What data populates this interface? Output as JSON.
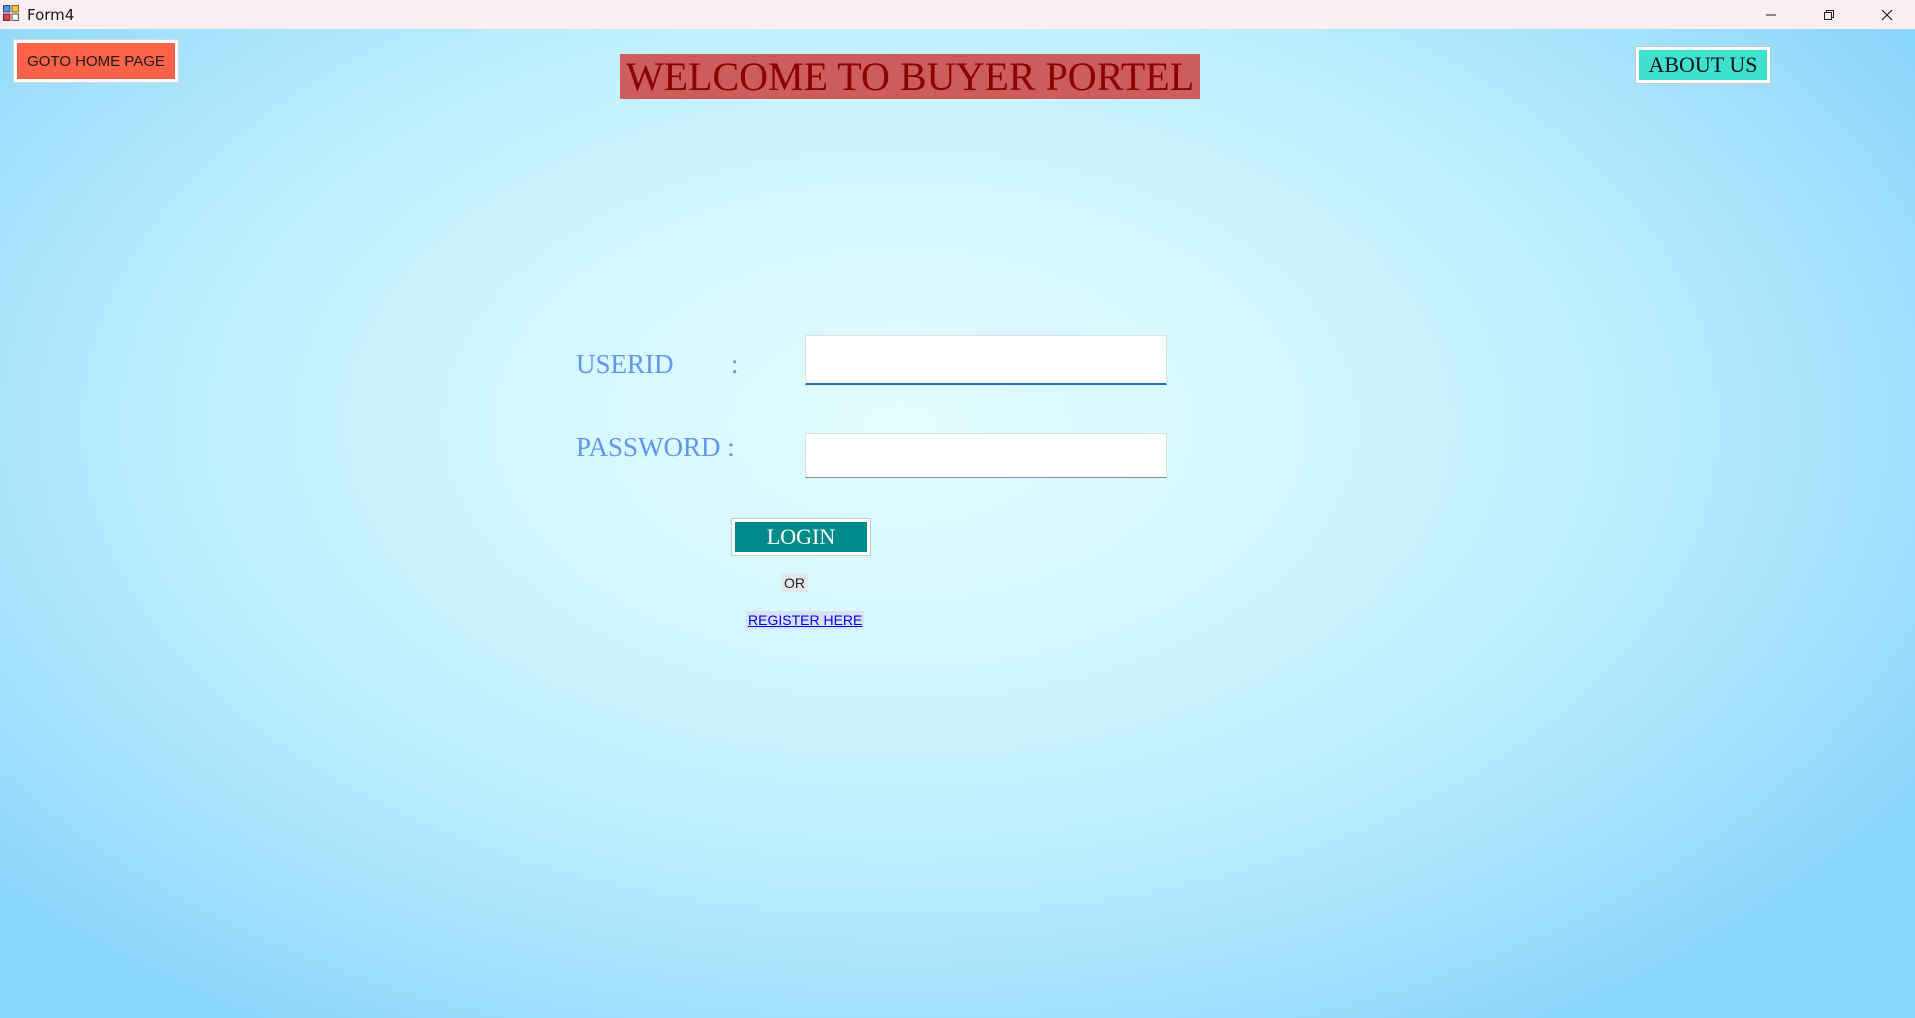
{
  "window": {
    "title": "Form4",
    "icons": {
      "app": "form-app-icon",
      "minimize": "minimize-icon",
      "restore": "restore-icon",
      "close": "close-icon"
    }
  },
  "header": {
    "home_button_label": "GOTO HOME PAGE",
    "page_title": "WELCOME TO BUYER PORTEL",
    "about_button_label": "ABOUT US"
  },
  "login_form": {
    "userid_label": "USERID",
    "userid_colon": ":",
    "userid_value": "",
    "password_label": "PASSWORD :",
    "password_value": "",
    "login_button_label": "LOGIN",
    "or_label": "OR",
    "register_link_label": "REGISTER HERE"
  },
  "colors": {
    "home_button_bg": "#ff6347",
    "title_bg": "#cd5c5c",
    "title_text": "#8b0000",
    "about_button_bg": "#40e0d0",
    "field_label_text": "#6495ed",
    "login_button_bg": "#008b8b",
    "link_text": "#0000ee",
    "background": "#c8f3ff"
  }
}
